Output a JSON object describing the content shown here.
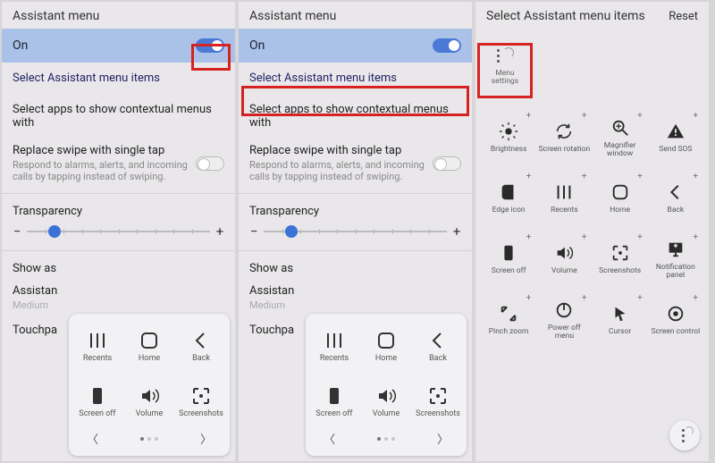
{
  "screen1": {
    "title": "Assistant menu",
    "toggle_label": "On",
    "select_items": "Select Assistant menu items",
    "select_apps": "Select apps to show contextual menus with",
    "replace_swipe_label": "Replace swipe with single tap",
    "replace_swipe_sub": "Respond to alarms, alerts, and incoming calls by tapping instead of swiping.",
    "transparency_label": "Transparency",
    "show_as": "Show as",
    "assistant_plus": "Assistan",
    "assistant_plus_sub": "Medium",
    "touchpad": "Touchpa",
    "popup": {
      "items": [
        {
          "label": "Recents"
        },
        {
          "label": "Home"
        },
        {
          "label": "Back"
        },
        {
          "label": "Screen off"
        },
        {
          "label": "Volume"
        },
        {
          "label": "Screenshots"
        }
      ]
    }
  },
  "screen2": {
    "title": "Assistant menu",
    "toggle_label": "On",
    "select_items": "Select Assistant menu items",
    "select_apps": "Select apps to show contextual menus with",
    "replace_swipe_label": "Replace swipe with single tap",
    "replace_swipe_sub": "Respond to alarms, alerts, and incoming calls by tapping instead of swiping.",
    "transparency_label": "Transparency",
    "show_as": "Show as",
    "assistant_plus": "Assistan",
    "assistant_plus_sub": "Medium",
    "touchpad": "Touchpa",
    "popup": {
      "items": [
        {
          "label": "Recents"
        },
        {
          "label": "Home"
        },
        {
          "label": "Back"
        },
        {
          "label": "Screen off"
        },
        {
          "label": "Volume"
        },
        {
          "label": "Screenshots"
        }
      ]
    }
  },
  "screen3": {
    "title": "Select Assistant menu items",
    "reset": "Reset",
    "menu_settings": "Menu settings",
    "grid": [
      {
        "label": "Brightness",
        "icon": "brightness"
      },
      {
        "label": "Screen rotation",
        "icon": "rotation"
      },
      {
        "label": "Magnifier window",
        "icon": "magnifier"
      },
      {
        "label": "Send SOS",
        "icon": "sos"
      },
      {
        "label": "Edge icon",
        "icon": "edge"
      },
      {
        "label": "Recents",
        "icon": "recents"
      },
      {
        "label": "Home",
        "icon": "home"
      },
      {
        "label": "Back",
        "icon": "back"
      },
      {
        "label": "Screen off",
        "icon": "screenoff"
      },
      {
        "label": "Volume",
        "icon": "volume"
      },
      {
        "label": "Screenshots",
        "icon": "screenshot"
      },
      {
        "label": "Notification panel",
        "icon": "notif"
      },
      {
        "label": "Pinch zoom",
        "icon": "pinch"
      },
      {
        "label": "Power off menu",
        "icon": "power"
      },
      {
        "label": "Cursor",
        "icon": "cursor"
      },
      {
        "label": "Screen control",
        "icon": "control"
      }
    ]
  }
}
